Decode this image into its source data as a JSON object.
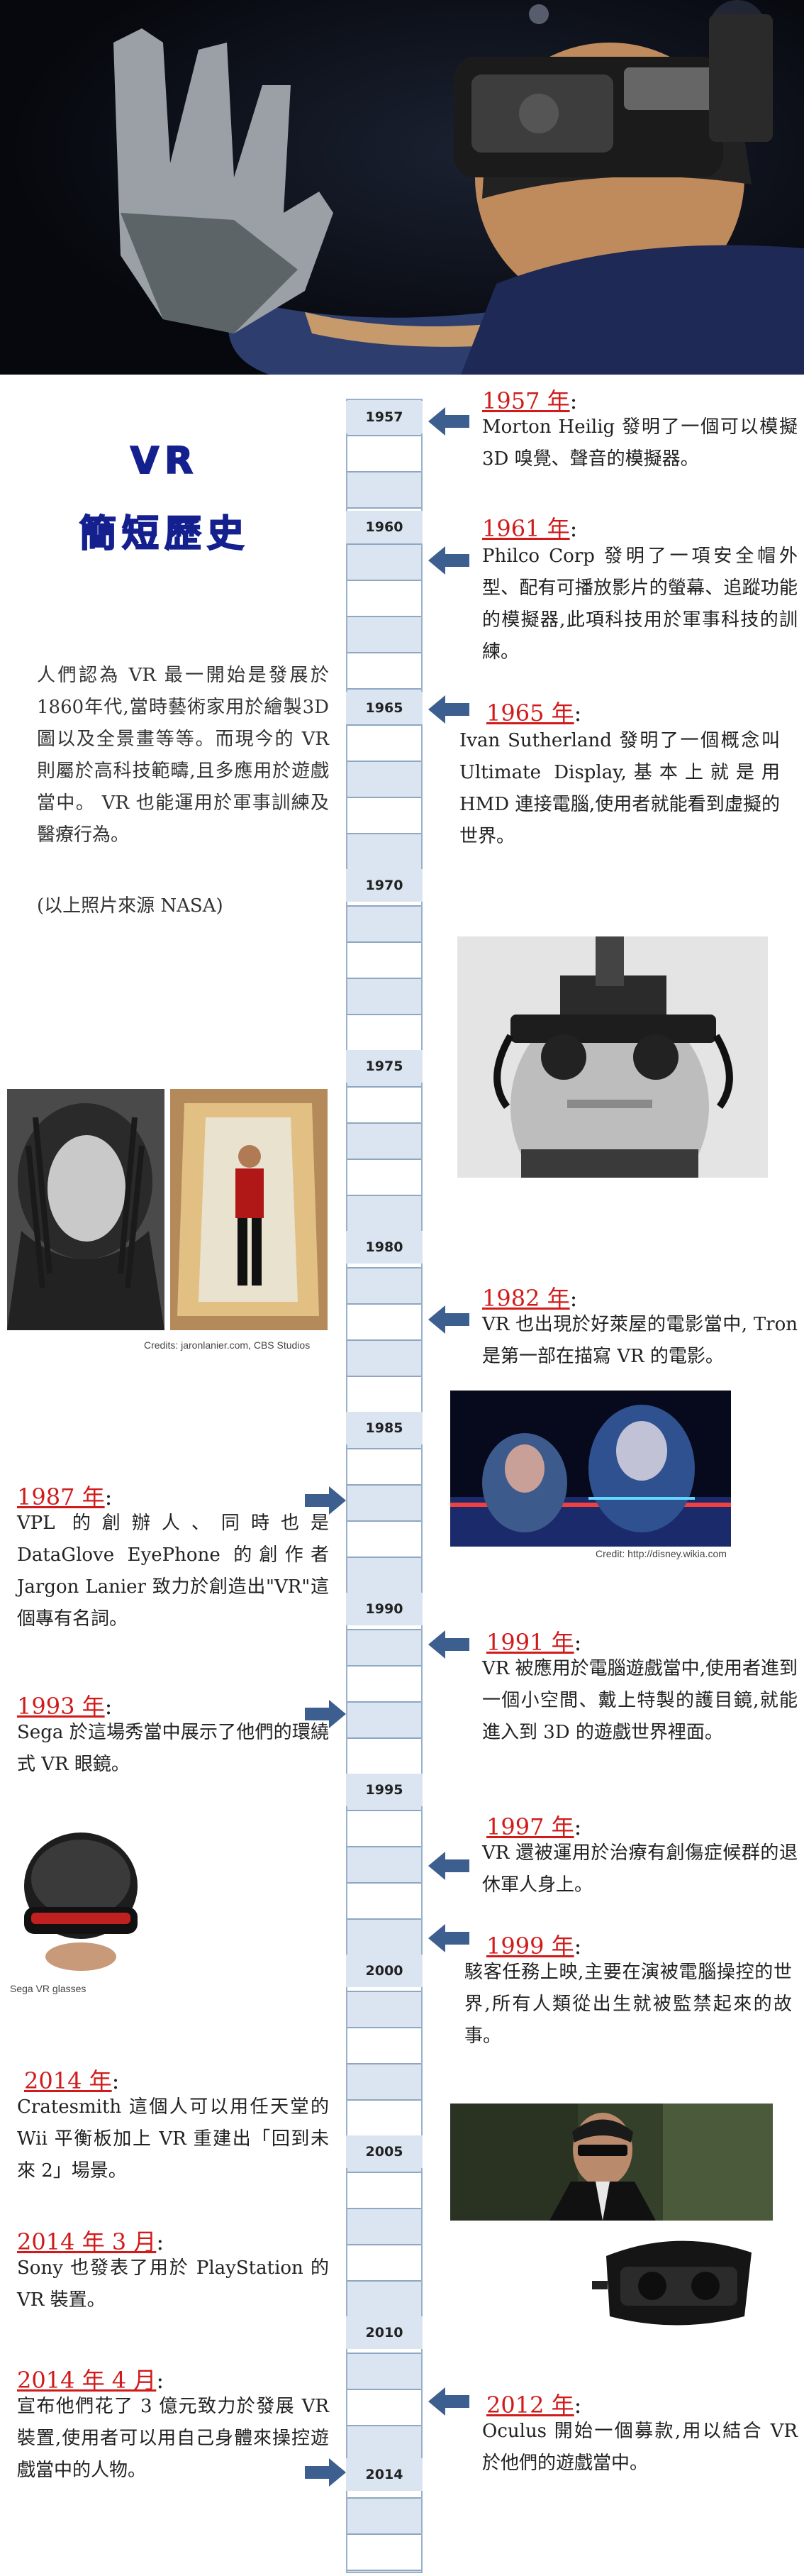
{
  "title": {
    "line1": "VR",
    "line2": "簡短歷史"
  },
  "intro": {
    "paragraph": "人們認為 VR 最一開始是發展於1860年代,當時藝術家用於繪製3D圖以及全景畫等等。而現今的 VR 則屬於高科技範疇,且多應用於遊戲當中。 VR 也能運用於軍事訓練及醫療行為。",
    "source": "(以上照片來源 NASA)"
  },
  "timeline": {
    "years": [
      "1957",
      "1960",
      "1965",
      "1970",
      "1975",
      "1980",
      "1985",
      "1990",
      "1995",
      "2000",
      "2005",
      "2010",
      "2014"
    ]
  },
  "entries": {
    "e1957": {
      "year": "1957 年",
      "text": "Morton Heilig 發明了一個可以模擬 3D 嗅覺、聲音的模擬器。"
    },
    "e1961": {
      "year": "1961 年",
      "text": "Philco Corp 發明了一項安全帽外型、配有可播放影片的螢幕、追蹤功能的模擬器,此項科技用於軍事科技的訓練。"
    },
    "e1965": {
      "year": "1965 年",
      "text": "Ivan Sutherland 發明了一個概念叫 Ultimate Display,基本上就是用 HMD 連接電腦,使用者就能看到虛擬的世界。"
    },
    "e1982": {
      "year": "1982 年",
      "text": "VR 也出現於好萊屋的電影當中, Tron 是第一部在描寫 VR 的電影。"
    },
    "e1987": {
      "year": "1987 年",
      "text": "VPL 的創辦人、同時也是 DataGlove EyePhone 的創作者 Jargon Lanier 致力於創造出\"VR\"這個專有名詞。"
    },
    "e1991": {
      "year": "1991 年",
      "text": "VR 被應用於電腦遊戲當中,使用者進到一個小空間、戴上特製的護目鏡,就能進入到 3D 的遊戲世界裡面。"
    },
    "e1993": {
      "year": "1993 年",
      "text": "Sega 於這場秀當中展示了他們的環繞式 VR 眼鏡。"
    },
    "e1997": {
      "year": "1997 年",
      "text": "VR 還被運用於治療有創傷症候群的退休軍人身上。"
    },
    "e1999": {
      "year": "1999 年",
      "text": "駭客任務上映,主要在演被電腦操控的世界,所有人類從出生就被監禁起來的故事。"
    },
    "e2014a": {
      "year": "2014 年",
      "text": "Cratesmith 這個人可以用任天堂的 Wii 平衡板加上 VR 重建出「回到未來 2」場景。"
    },
    "e2014b": {
      "year": "2014 年 3 月",
      "text": "Sony 也發表了用於 PlayStation 的 VR 裝置。"
    },
    "e2014c": {
      "year": "2014 年 4 月",
      "text": "宣布他們花了 3 億元致力於發展 VR 裝置,使用者可以用自己身體來操控遊戲當中的人物。"
    },
    "e2012": {
      "year": "2012 年",
      "text": "Oculus 開始一個募款,用以結合 VR 於他們的遊戲當中。"
    }
  },
  "captions": {
    "lanier": "Credits: jaronlanier.com, CBS Studios",
    "tron": "Credit: http://disney.wikia.com",
    "sega": "Sega VR glasses"
  },
  "colors": {
    "arrow": "#3d5f8f",
    "title": "#15208f",
    "year": "#d11b1b",
    "bar": "#dbe5f1"
  }
}
